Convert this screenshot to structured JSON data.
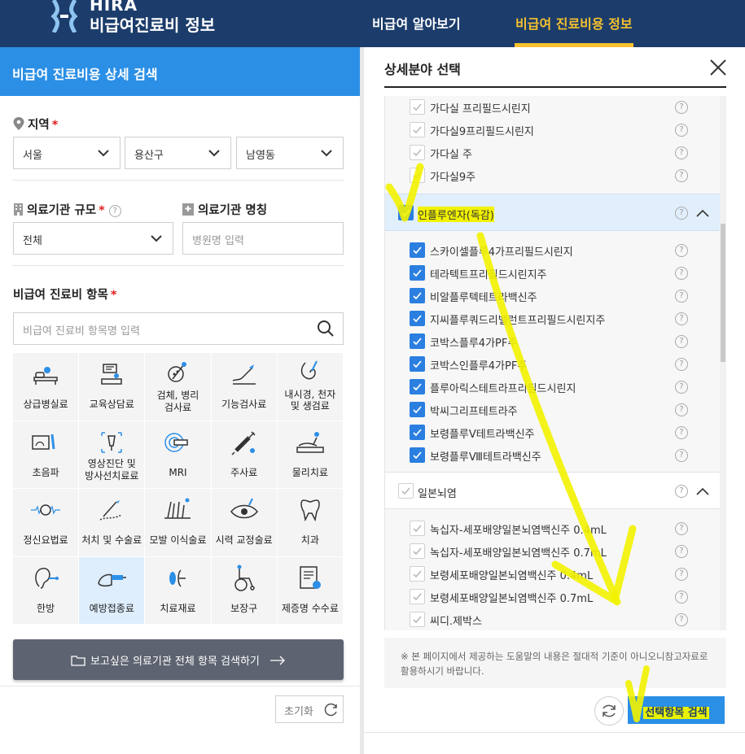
{
  "header": {
    "logo_top": "HIRA",
    "logo_sub": "비급여진료비 정보",
    "nav": [
      "비급여 알아보기",
      "비급여 진료비용 정보"
    ]
  },
  "left": {
    "title": "비급여 진료비용 상세 검색",
    "region": {
      "label": "지역",
      "required": "*",
      "selects": [
        "서울",
        "용산구",
        "남영동"
      ]
    },
    "scale": {
      "label": "의료기관 규모",
      "required": "*",
      "help": "?",
      "value": "전체"
    },
    "name": {
      "label": "의료기관 명칭",
      "placeholder": "병원명 입력"
    },
    "item": {
      "label": "비급여 진료비 항목",
      "required": "*",
      "placeholder": "비급여 진료비 항목명 입력"
    },
    "categories": [
      "상급병실료",
      "교육상담료",
      "검체, 병리\n검사료",
      "기능검사료",
      "내시경, 천자\n및 생검료",
      "초음파",
      "영상진단 및\n방사선치료료",
      "MRI",
      "주사료",
      "물리치료",
      "정신요법료",
      "처치 및 수술료",
      "모발 이식술료",
      "시력 교정술료",
      "치과",
      "한방",
      "예방접종료",
      "치료재료",
      "보장구",
      "제증명 수수료"
    ],
    "search_all_label": "보고싶은 의료기관 전체 항목 검색하기",
    "reset_label": "초기화"
  },
  "right": {
    "title": "상세분야 선택",
    "group_top_items": [
      "가다실 프리필드시린지",
      "가다실9프리필드시린지",
      "가다실 주",
      "가다실9주"
    ],
    "group_flu": {
      "title": "인플루엔자(독감)",
      "items": [
        "스카이셀플루4가프리필드시린지",
        "테라텍트프리필드시린지주",
        "비알플루텍테트라백신주",
        "지씨플루쿼드리밸런트프리필드시린지주",
        "코박스플루4가PF주",
        "코박스인플루4가PF주",
        "플루아릭스테트라프리필드시린지",
        "박씨그리프테트라주",
        "보령플루Ⅴ테트라백신주",
        "보령플루Ⅷ테트라백신주"
      ]
    },
    "group_je": {
      "title": "일본뇌염",
      "items": [
        "녹십자-세포배양일본뇌염백신주 0.4mL",
        "녹십자-세포배양일본뇌염백신주 0.7mL",
        "보령세포배양일본뇌염백신주 0.4mL",
        "보령세포배양일본뇌염백신주 0.7mL",
        "씨디.제박스"
      ]
    },
    "note": "※ 본 페이지에서 제공하는 도움말의 내용은 절대적 기준이 아니오니참고자료로 활용하시기 바랍니다.",
    "search_label": "선택항목 검색"
  },
  "colors": {
    "header_bg": "#1c3d6b",
    "accent_yellow": "#f6c12d",
    "primary_blue": "#2b8fe6",
    "checkbox_blue": "#2b7fe0",
    "annotation": "#f2f200"
  }
}
